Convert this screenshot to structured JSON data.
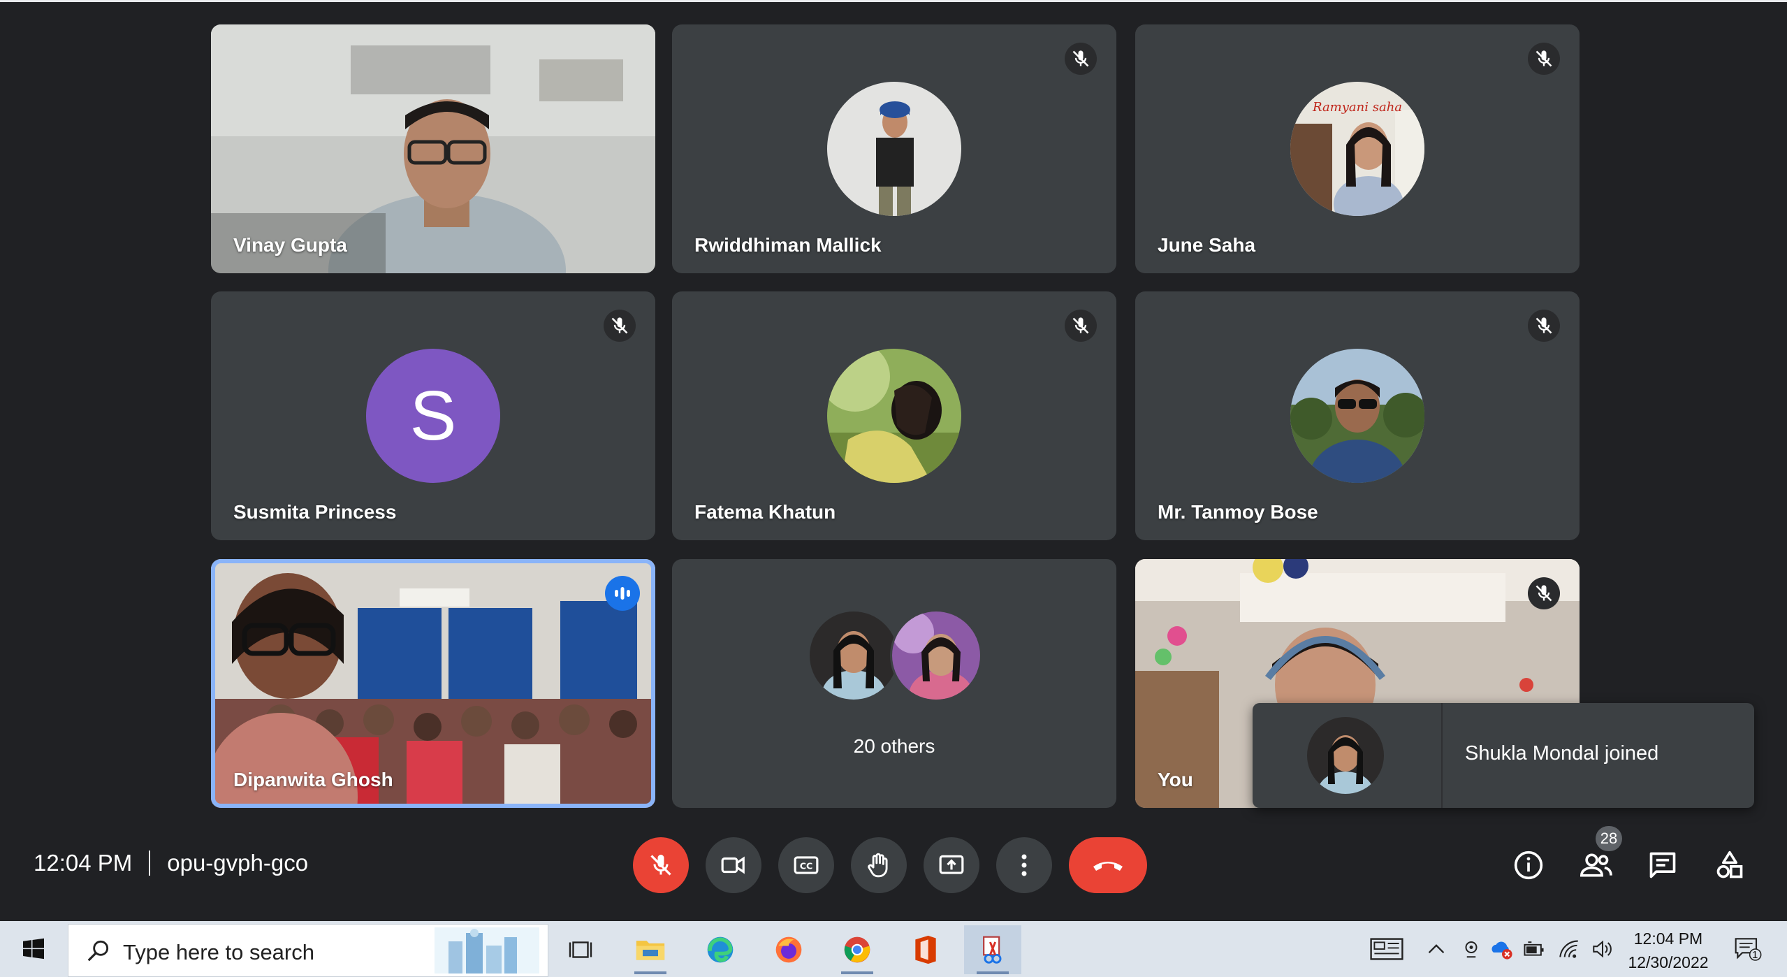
{
  "tiles": [
    {
      "name": "Vinay Gupta"
    },
    {
      "name": "Rwiddhiman Mallick"
    },
    {
      "name": "June Saha",
      "avatar_text": "Ramyani saha"
    },
    {
      "name": "Susmita Princess",
      "initial": "S"
    },
    {
      "name": "Fatema Khatun"
    },
    {
      "name": "Mr. Tanmoy Bose"
    },
    {
      "name": "Dipanwita Ghosh"
    },
    {
      "others_label": "20 others"
    },
    {
      "name": "You"
    }
  ],
  "toast": {
    "text": "Shukla Mondal joined"
  },
  "meeting": {
    "time": "12:04 PM",
    "code": "opu-gvph-gco"
  },
  "controls": {
    "mic": "microphone-off-icon",
    "camera": "camera-icon",
    "captions": "captions-icon",
    "hand": "raise-hand-icon",
    "present": "present-icon",
    "more": "more-options-icon",
    "end": "end-call-icon"
  },
  "right_controls": {
    "people_count": "28"
  },
  "taskbar": {
    "search_placeholder": "Type here to search",
    "time": "12:04 PM",
    "date": "12/30/2022",
    "notification_count": "1"
  },
  "colors": {
    "background": "#202124",
    "tile": "#3c4043",
    "end_call": "#ea4335",
    "active_speaker": "#8ab4f8"
  }
}
